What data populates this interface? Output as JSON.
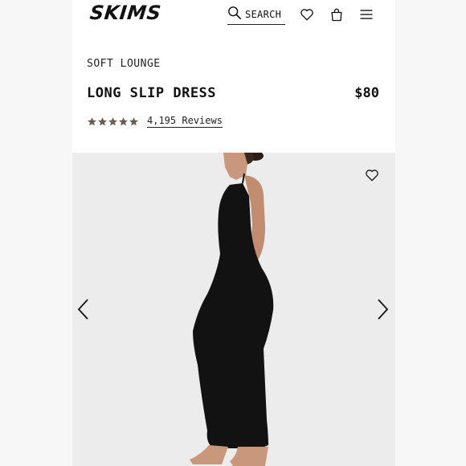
{
  "header": {
    "logo": "SKIMS",
    "search_label": "SEARCH",
    "icons": [
      "search-icon",
      "heart-icon",
      "bag-icon",
      "menu-icon"
    ]
  },
  "product": {
    "category": "SOFT LOUNGE",
    "title": "LONG SLIP DRESS",
    "price": "$80",
    "rating": 5,
    "reviews_label": "4,195 Reviews"
  },
  "gallery": {
    "icons": [
      "wishlist-heart-icon",
      "chevron-left-icon",
      "chevron-right-icon"
    ]
  },
  "colors": {
    "star": "#6b5f55",
    "text": "#111111",
    "image_bg": "#ececec",
    "dress": "#121212"
  }
}
